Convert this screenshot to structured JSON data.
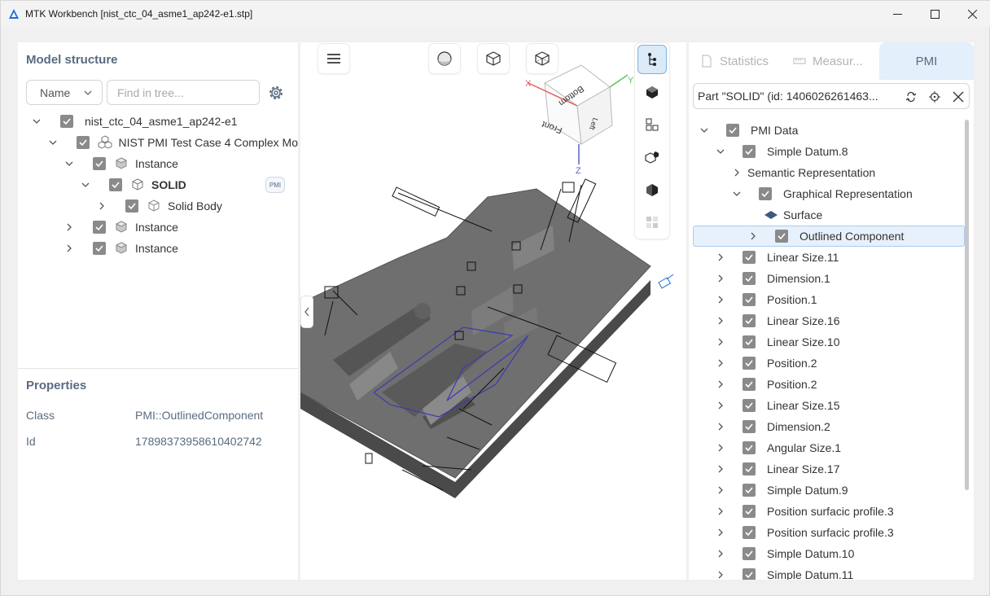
{
  "window": {
    "title": "MTK Workbench [nist_ctc_04_asme1_ap242-e1.stp]"
  },
  "model_structure": {
    "title": "Model structure",
    "sort_select": "Name",
    "search_placeholder": "Find in tree...",
    "nodes": [
      {
        "label": "nist_ctc_04_asme1_ap242-e1",
        "level": 0,
        "expanded": true,
        "icon": "none"
      },
      {
        "label": "NIST PMI Test Case 4 Complex Mo",
        "level": 1,
        "expanded": true,
        "icon": "assembly-icon"
      },
      {
        "label": "Instance",
        "level": 2,
        "expanded": true,
        "icon": "instance-icon"
      },
      {
        "label": "SOLID",
        "level": 3,
        "expanded": true,
        "icon": "part-icon",
        "bold": true,
        "badge": "PMI"
      },
      {
        "label": "Solid Body",
        "level": 4,
        "expanded": false,
        "icon": "body-icon"
      },
      {
        "label": "Instance",
        "level": 2,
        "expanded": false,
        "icon": "instance-icon"
      },
      {
        "label": "Instance",
        "level": 2,
        "expanded": false,
        "icon": "instance-icon"
      }
    ]
  },
  "properties": {
    "title": "Properties",
    "rows": [
      {
        "key": "Class",
        "value": "PMI::OutlinedComponent"
      },
      {
        "key": "Id",
        "value": "17898373958610402742"
      }
    ]
  },
  "viewcube": {
    "faces": {
      "top": "Bottom",
      "front": "Front",
      "right": "Left"
    },
    "axes": {
      "x": "X",
      "y": "Y",
      "z": "Z"
    }
  },
  "right_panel": {
    "tabs": [
      {
        "label": "Statistics",
        "active": false
      },
      {
        "label": "Measur...",
        "active": false
      },
      {
        "label": "PMI",
        "active": true
      }
    ],
    "part_label": "Part \"SOLID\" (id: 1406026261463...",
    "nodes": [
      {
        "label": "PMI Data",
        "level": 0,
        "expanded": true,
        "checkbox": true
      },
      {
        "label": "Simple Datum.8",
        "level": 1,
        "expanded": true,
        "checkbox": true
      },
      {
        "label": "Semantic Representation",
        "level": 2,
        "expanded": false,
        "checkbox": false
      },
      {
        "label": "Graphical Representation",
        "level": 2,
        "expanded": true,
        "checkbox": true
      },
      {
        "label": "Surface",
        "level": 3,
        "leaf": true,
        "checkbox": false,
        "icon": "surface-icon"
      },
      {
        "label": "Outlined Component",
        "level": 3,
        "expanded": false,
        "checkbox": true,
        "selected": true
      },
      {
        "label": "Linear Size.11",
        "level": 1,
        "expanded": false,
        "checkbox": true
      },
      {
        "label": "Dimension.1",
        "level": 1,
        "expanded": false,
        "checkbox": true
      },
      {
        "label": "Position.1",
        "level": 1,
        "expanded": false,
        "checkbox": true
      },
      {
        "label": "Linear Size.16",
        "level": 1,
        "expanded": false,
        "checkbox": true
      },
      {
        "label": "Linear Size.10",
        "level": 1,
        "expanded": false,
        "checkbox": true
      },
      {
        "label": "Position.2",
        "level": 1,
        "expanded": false,
        "checkbox": true
      },
      {
        "label": "Position.2",
        "level": 1,
        "expanded": false,
        "checkbox": true
      },
      {
        "label": "Linear Size.15",
        "level": 1,
        "expanded": false,
        "checkbox": true
      },
      {
        "label": "Dimension.2",
        "level": 1,
        "expanded": false,
        "checkbox": true
      },
      {
        "label": "Angular Size.1",
        "level": 1,
        "expanded": false,
        "checkbox": true
      },
      {
        "label": "Linear Size.17",
        "level": 1,
        "expanded": false,
        "checkbox": true
      },
      {
        "label": "Simple Datum.9",
        "level": 1,
        "expanded": false,
        "checkbox": true
      },
      {
        "label": "Position surfacic profile.3",
        "level": 1,
        "expanded": false,
        "checkbox": true
      },
      {
        "label": "Position surfacic profile.3",
        "level": 1,
        "expanded": false,
        "checkbox": true
      },
      {
        "label": "Simple Datum.10",
        "level": 1,
        "expanded": false,
        "checkbox": true
      },
      {
        "label": "Simple Datum.11",
        "level": 1,
        "expanded": false,
        "checkbox": true
      }
    ]
  },
  "colors": {
    "accent": "#1e6fd9",
    "panel_title": "#5a6b80",
    "checkbox": "#8a8a8a",
    "selection": "#e6f1fb",
    "model_gray": "#6c6c6c"
  }
}
